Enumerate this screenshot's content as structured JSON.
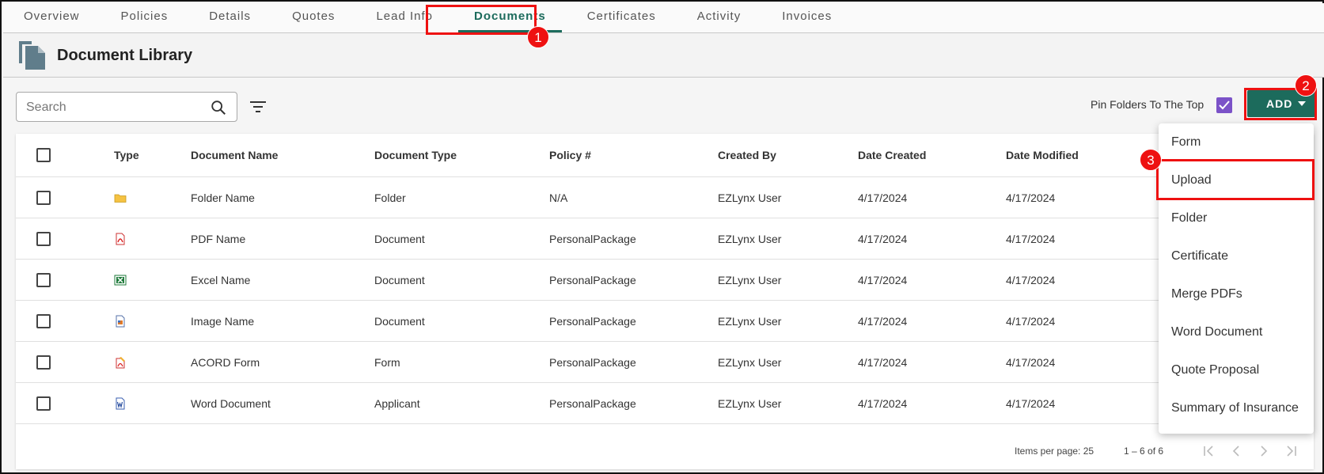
{
  "tabs": [
    {
      "label": "Overview"
    },
    {
      "label": "Policies"
    },
    {
      "label": "Details"
    },
    {
      "label": "Quotes"
    },
    {
      "label": "Lead Info"
    },
    {
      "label": "Documents",
      "active": true
    },
    {
      "label": "Certificates"
    },
    {
      "label": "Activity"
    },
    {
      "label": "Invoices"
    }
  ],
  "header": {
    "title": "Document Library",
    "icon": "document-library-icon"
  },
  "toolbar": {
    "search_placeholder": "Search",
    "pin_label": "Pin Folders To The Top",
    "pin_checked": true,
    "add_label": "ADD"
  },
  "table": {
    "columns": [
      "Type",
      "Document Name",
      "Document Type",
      "Policy #",
      "Created By",
      "Date Created",
      "Date Modified"
    ],
    "rows": [
      {
        "icon": "folder-icon",
        "name": "Folder Name",
        "doc_type": "Folder",
        "policy": "N/A",
        "created_by": "EZLynx User",
        "date_created": "4/17/2024",
        "date_modified": "4/17/2024"
      },
      {
        "icon": "pdf-icon",
        "name": "PDF Name",
        "doc_type": "Document",
        "policy": "PersonalPackage",
        "created_by": "EZLynx User",
        "date_created": "4/17/2024",
        "date_modified": "4/17/2024"
      },
      {
        "icon": "excel-icon",
        "name": "Excel Name",
        "doc_type": "Document",
        "policy": "PersonalPackage",
        "created_by": "EZLynx User",
        "date_created": "4/17/2024",
        "date_modified": "4/17/2024"
      },
      {
        "icon": "image-icon",
        "name": "Image Name",
        "doc_type": "Document",
        "policy": "PersonalPackage",
        "created_by": "EZLynx User",
        "date_created": "4/17/2024",
        "date_modified": "4/17/2024"
      },
      {
        "icon": "acord-form-icon",
        "name": "ACORD Form",
        "doc_type": "Form",
        "policy": "PersonalPackage",
        "created_by": "EZLynx User",
        "date_created": "4/17/2024",
        "date_modified": "4/17/2024"
      },
      {
        "icon": "word-icon",
        "name": "Word Document",
        "doc_type": "Applicant",
        "policy": "PersonalPackage",
        "created_by": "EZLynx User",
        "date_created": "4/17/2024",
        "date_modified": "4/17/2024"
      }
    ]
  },
  "paginator": {
    "items_per_page": "Items per page: 25",
    "range": "1 – 6 of 6"
  },
  "add_menu": {
    "items": [
      "Form",
      "Upload",
      "Folder",
      "Certificate",
      "Merge PDFs",
      "Word Document",
      "Quote Proposal",
      "Summary of Insurance"
    ]
  },
  "annotations": {
    "badge_1": "1",
    "badge_2": "2",
    "badge_3": "3"
  },
  "colors": {
    "accent": "#1c6b5c",
    "checkbox_checked": "#7b52c8",
    "annotation": "#ee1111"
  }
}
